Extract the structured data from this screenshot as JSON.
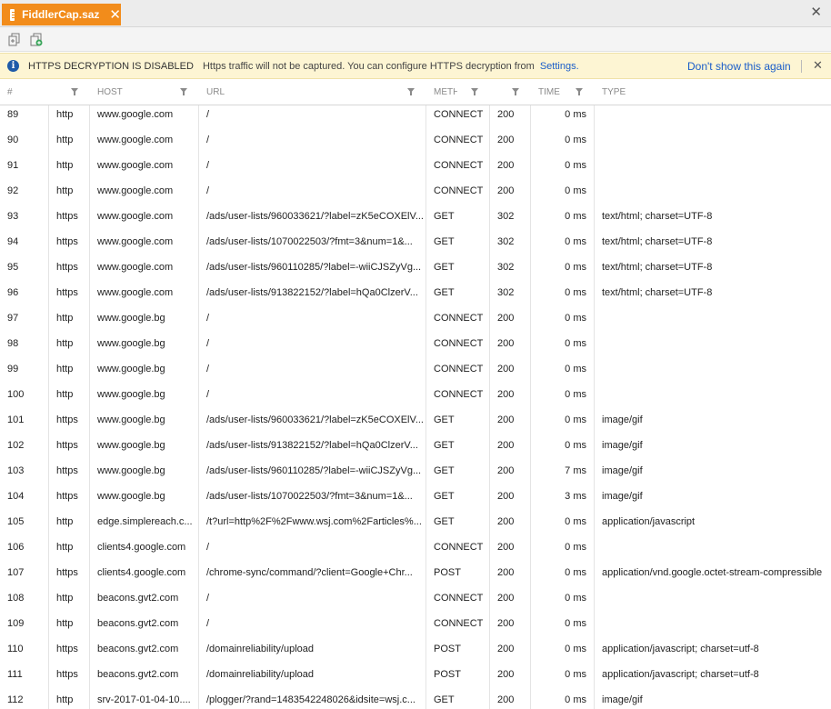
{
  "tab": {
    "label": "FiddlerCap.saz",
    "close": "✕"
  },
  "window_close": "✕",
  "toolbar": {
    "buttons": [
      "replay-icon",
      "add-session-icon"
    ]
  },
  "infobar": {
    "title": "HTTPS DECRYPTION IS DISABLED",
    "message": "Https traffic will not be captured. You can configure HTTPS decryption from",
    "link": "Settings.",
    "dont_show": "Don't show this again",
    "close": "✕"
  },
  "columns": [
    "#",
    "",
    "HOST",
    "URL",
    "METH",
    "",
    "TIME",
    "TYPE"
  ],
  "rows": [
    {
      "id": "89",
      "proto": "http",
      "host": "www.google.com",
      "url": "/",
      "method": "CONNECT",
      "status": "200",
      "time": "0 ms",
      "type": ""
    },
    {
      "id": "90",
      "proto": "http",
      "host": "www.google.com",
      "url": "/",
      "method": "CONNECT",
      "status": "200",
      "time": "0 ms",
      "type": ""
    },
    {
      "id": "91",
      "proto": "http",
      "host": "www.google.com",
      "url": "/",
      "method": "CONNECT",
      "status": "200",
      "time": "0 ms",
      "type": ""
    },
    {
      "id": "92",
      "proto": "http",
      "host": "www.google.com",
      "url": "/",
      "method": "CONNECT",
      "status": "200",
      "time": "0 ms",
      "type": ""
    },
    {
      "id": "93",
      "proto": "https",
      "host": "www.google.com",
      "url": "/ads/user-lists/960033621/?label=zK5eCOXElV...",
      "method": "GET",
      "status": "302",
      "time": "0 ms",
      "type": "text/html; charset=UTF-8"
    },
    {
      "id": "94",
      "proto": "https",
      "host": "www.google.com",
      "url": "/ads/user-lists/1070022503/?fmt=3&num=1&...",
      "method": "GET",
      "status": "302",
      "time": "0 ms",
      "type": "text/html; charset=UTF-8"
    },
    {
      "id": "95",
      "proto": "https",
      "host": "www.google.com",
      "url": "/ads/user-lists/960110285/?label=-wiiCJSZyVg...",
      "method": "GET",
      "status": "302",
      "time": "0 ms",
      "type": "text/html; charset=UTF-8"
    },
    {
      "id": "96",
      "proto": "https",
      "host": "www.google.com",
      "url": "/ads/user-lists/913822152/?label=hQa0ClzerV...",
      "method": "GET",
      "status": "302",
      "time": "0 ms",
      "type": "text/html; charset=UTF-8"
    },
    {
      "id": "97",
      "proto": "http",
      "host": "www.google.bg",
      "url": "/",
      "method": "CONNECT",
      "status": "200",
      "time": "0 ms",
      "type": ""
    },
    {
      "id": "98",
      "proto": "http",
      "host": "www.google.bg",
      "url": "/",
      "method": "CONNECT",
      "status": "200",
      "time": "0 ms",
      "type": ""
    },
    {
      "id": "99",
      "proto": "http",
      "host": "www.google.bg",
      "url": "/",
      "method": "CONNECT",
      "status": "200",
      "time": "0 ms",
      "type": ""
    },
    {
      "id": "100",
      "proto": "http",
      "host": "www.google.bg",
      "url": "/",
      "method": "CONNECT",
      "status": "200",
      "time": "0 ms",
      "type": ""
    },
    {
      "id": "101",
      "proto": "https",
      "host": "www.google.bg",
      "url": "/ads/user-lists/960033621/?label=zK5eCOXElV...",
      "method": "GET",
      "status": "200",
      "time": "0 ms",
      "type": "image/gif"
    },
    {
      "id": "102",
      "proto": "https",
      "host": "www.google.bg",
      "url": "/ads/user-lists/913822152/?label=hQa0ClzerV...",
      "method": "GET",
      "status": "200",
      "time": "0 ms",
      "type": "image/gif"
    },
    {
      "id": "103",
      "proto": "https",
      "host": "www.google.bg",
      "url": "/ads/user-lists/960110285/?label=-wiiCJSZyVg...",
      "method": "GET",
      "status": "200",
      "time": "7 ms",
      "type": "image/gif"
    },
    {
      "id": "104",
      "proto": "https",
      "host": "www.google.bg",
      "url": "/ads/user-lists/1070022503/?fmt=3&num=1&...",
      "method": "GET",
      "status": "200",
      "time": "3 ms",
      "type": "image/gif"
    },
    {
      "id": "105",
      "proto": "http",
      "host": "edge.simplereach.c...",
      "url": "/t?url=http%2F%2Fwww.wsj.com%2Farticles%...",
      "method": "GET",
      "status": "200",
      "time": "0 ms",
      "type": "application/javascript"
    },
    {
      "id": "106",
      "proto": "http",
      "host": "clients4.google.com",
      "url": "/",
      "method": "CONNECT",
      "status": "200",
      "time": "0 ms",
      "type": ""
    },
    {
      "id": "107",
      "proto": "https",
      "host": "clients4.google.com",
      "url": "/chrome-sync/command/?client=Google+Chr...",
      "method": "POST",
      "status": "200",
      "time": "0 ms",
      "type": "application/vnd.google.octet-stream-compressible"
    },
    {
      "id": "108",
      "proto": "http",
      "host": "beacons.gvt2.com",
      "url": "/",
      "method": "CONNECT",
      "status": "200",
      "time": "0 ms",
      "type": ""
    },
    {
      "id": "109",
      "proto": "http",
      "host": "beacons.gvt2.com",
      "url": "/",
      "method": "CONNECT",
      "status": "200",
      "time": "0 ms",
      "type": ""
    },
    {
      "id": "110",
      "proto": "https",
      "host": "beacons.gvt2.com",
      "url": "/domainreliability/upload",
      "method": "POST",
      "status": "200",
      "time": "0 ms",
      "type": "application/javascript; charset=utf-8"
    },
    {
      "id": "111",
      "proto": "https",
      "host": "beacons.gvt2.com",
      "url": "/domainreliability/upload",
      "method": "POST",
      "status": "200",
      "time": "0 ms",
      "type": "application/javascript; charset=utf-8"
    },
    {
      "id": "112",
      "proto": "http",
      "host": "srv-2017-01-04-10....",
      "url": "/plogger/?rand=1483542248026&idsite=wsj.c...",
      "method": "GET",
      "status": "200",
      "time": "0 ms",
      "type": "image/gif"
    }
  ]
}
